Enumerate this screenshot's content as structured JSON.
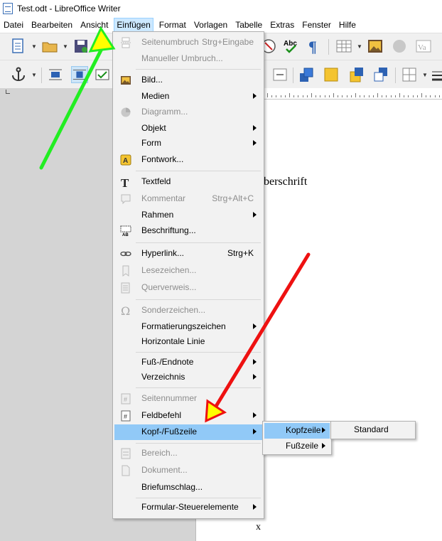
{
  "window": {
    "title": "Test.odt - LibreOffice Writer"
  },
  "menubar": [
    "Datei",
    "Bearbeiten",
    "Ansicht",
    "Einfügen",
    "Format",
    "Vorlagen",
    "Tabelle",
    "Extras",
    "Fenster",
    "Hilfe"
  ],
  "document": {
    "visible_heading_fragment": "berschrift",
    "visible_char": "x"
  },
  "insert_menu": [
    {
      "label": "Seitenumbruch",
      "shortcut": "Strg+Eingabe",
      "disabled": true,
      "icon": "page-break-icon"
    },
    {
      "label": "Manueller Umbruch...",
      "disabled": true
    },
    {
      "label": "Bild...",
      "icon": "image-icon"
    },
    {
      "label": "Medien",
      "submenu": true
    },
    {
      "label": "Diagramm...",
      "disabled": true,
      "icon": "chart-icon"
    },
    {
      "label": "Objekt",
      "submenu": true
    },
    {
      "label": "Form",
      "submenu": true
    },
    {
      "label": "Fontwork...",
      "icon": "fontwork-icon"
    },
    {
      "label": "Textfeld",
      "icon": "text-box-icon"
    },
    {
      "label": "Kommentar",
      "shortcut": "Strg+Alt+C",
      "disabled": true,
      "icon": "comment-icon"
    },
    {
      "label": "Rahmen",
      "submenu": true
    },
    {
      "label": "Beschriftung...",
      "icon": "caption-icon"
    },
    {
      "label": "Hyperlink...",
      "shortcut": "Strg+K",
      "icon": "hyperlink-icon"
    },
    {
      "label": "Lesezeichen...",
      "disabled": true,
      "icon": "bookmark-icon"
    },
    {
      "label": "Querverweis...",
      "disabled": true,
      "icon": "cross-reference-icon"
    },
    {
      "label": "Sonderzeichen...",
      "disabled": true,
      "icon": "omega-icon"
    },
    {
      "label": "Formatierungszeichen",
      "submenu": true
    },
    {
      "label": "Horizontale Linie"
    },
    {
      "label": "Fuß-/Endnote",
      "submenu": true
    },
    {
      "label": "Verzeichnis",
      "submenu": true
    },
    {
      "label": "Seitennummer",
      "disabled": true,
      "icon": "page-number-icon"
    },
    {
      "label": "Feldbefehl",
      "submenu": true,
      "icon": "field-icon"
    },
    {
      "label": "Kopf-/Fußzeile",
      "submenu": true,
      "highlighted": true
    },
    {
      "label": "Bereich...",
      "disabled": true,
      "icon": "section-icon"
    },
    {
      "label": "Dokument...",
      "disabled": true,
      "icon": "document-icon"
    },
    {
      "label": "Briefumschlag..."
    },
    {
      "label": "Formular-Steuerelemente",
      "submenu": true
    }
  ],
  "header_footer_submenu": [
    {
      "label": "Kopfzeile",
      "submenu": true,
      "highlighted": true
    },
    {
      "label": "Fußzeile",
      "submenu": true
    }
  ],
  "header_submenu": [
    {
      "label": "Standard"
    }
  ],
  "colors": {
    "menu_highlight": "#91c9f7",
    "green_arrow": "#22ee22",
    "red_arrow": "#ee1111"
  }
}
